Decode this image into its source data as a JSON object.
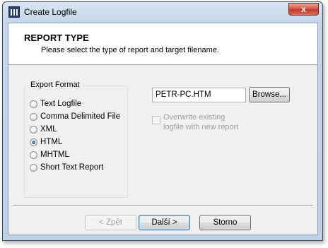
{
  "window": {
    "title": "Create Logfile",
    "close_label": "x"
  },
  "header": {
    "title": "REPORT TYPE",
    "subtitle": "Please select the type of report and target filename."
  },
  "export_format": {
    "label": "Export Format",
    "selected": "HTML",
    "options": [
      "Text Logfile",
      "Comma Delimited File",
      "XML",
      "HTML",
      "MHTML",
      "Short Text Report"
    ]
  },
  "target": {
    "filename": "PETR-PC.HTM",
    "browse_label": "Browse...",
    "overwrite_label_line1": "Overwrite existing",
    "overwrite_label_line2": "logfile with new report",
    "overwrite_checked": false,
    "overwrite_enabled": false
  },
  "footer": {
    "back_label": "< Zpět",
    "next_label": "Další >",
    "cancel_label": "Storno"
  }
}
